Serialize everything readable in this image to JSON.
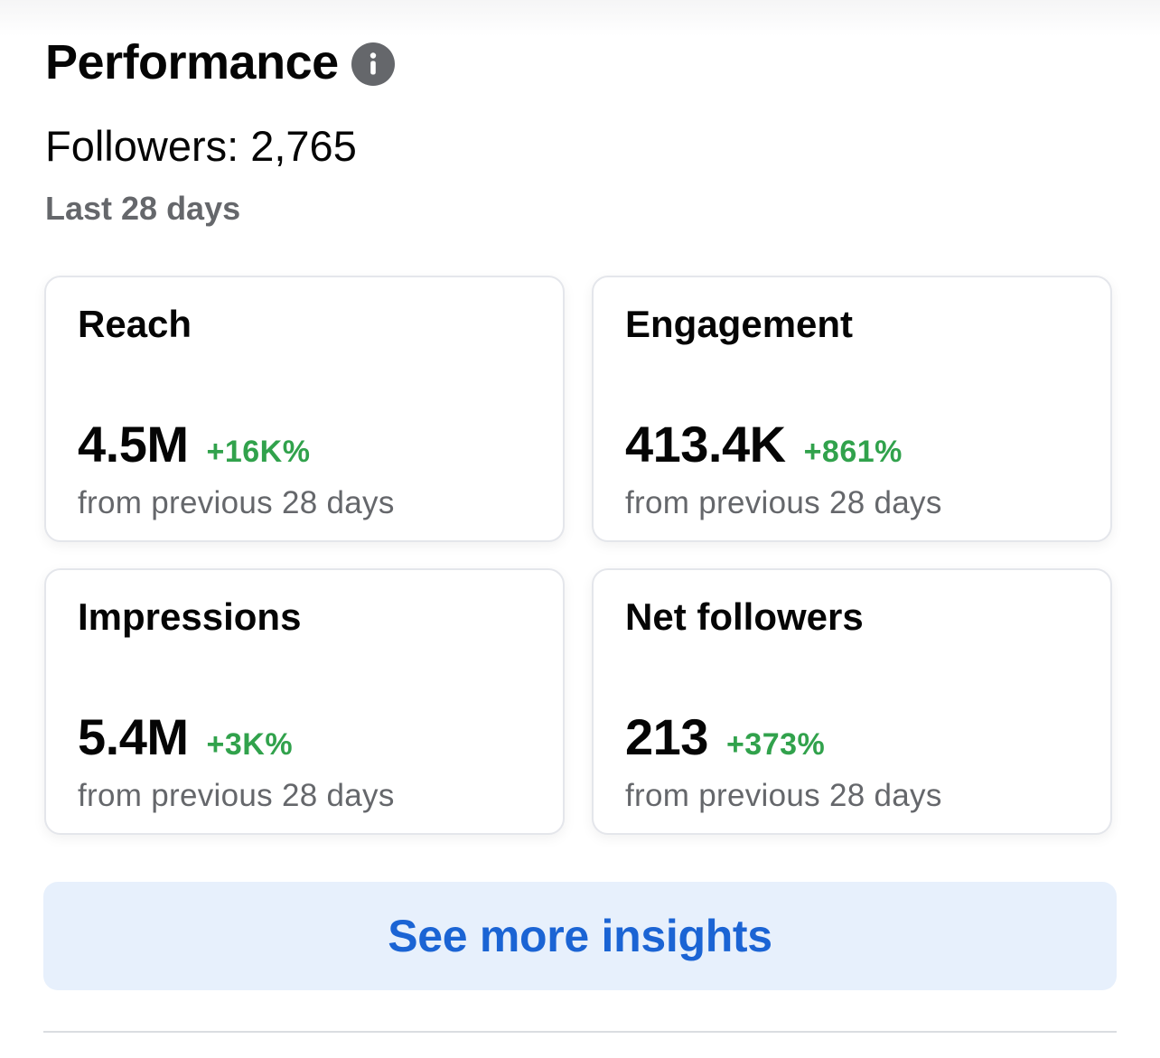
{
  "header": {
    "title": "Performance",
    "info_icon": "info-icon"
  },
  "followers": {
    "text": "Followers: 2,765"
  },
  "period": "Last 28 days",
  "cards": [
    {
      "title": "Reach",
      "value": "4.5M",
      "change": "+16K%",
      "caption": "from previous 28 days"
    },
    {
      "title": "Engagement",
      "value": "413.4K",
      "change": "+861%",
      "caption": "from previous 28 days"
    },
    {
      "title": "Impressions",
      "value": "5.4M",
      "change": "+3K%",
      "caption": "from previous 28 days"
    },
    {
      "title": "Net followers",
      "value": "213",
      "change": "+373%",
      "caption": "from previous 28 days"
    }
  ],
  "insights_button": {
    "label": "See more insights"
  },
  "colors": {
    "positive_change": "#31a24c",
    "link_blue": "#1b64d4",
    "button_bg": "#e7f0fc",
    "secondary_text": "#65676b"
  }
}
